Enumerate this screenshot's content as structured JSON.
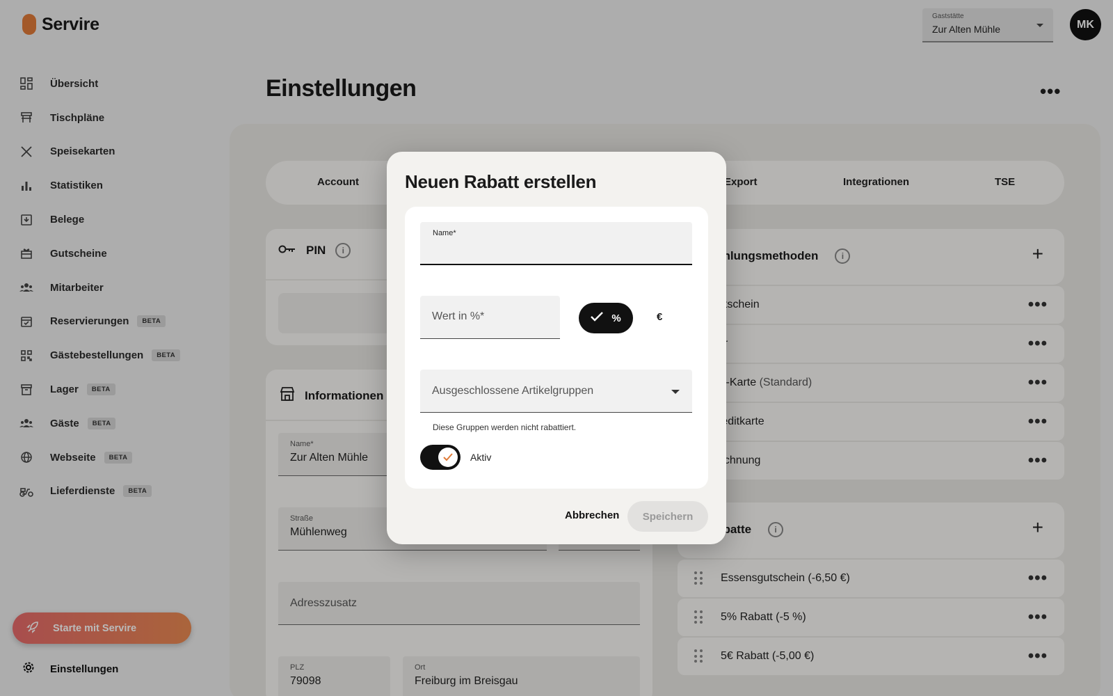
{
  "app": {
    "name": "Servire"
  },
  "sidebar": {
    "items": [
      {
        "label": "Übersicht",
        "icon": "dashboard-icon"
      },
      {
        "label": "Tischpläne",
        "icon": "table-icon"
      },
      {
        "label": "Speisekarten",
        "icon": "cutlery-icon"
      },
      {
        "label": "Statistiken",
        "icon": "bar-chart-icon"
      },
      {
        "label": "Belege",
        "icon": "receipt-icon"
      },
      {
        "label": "Gutscheine",
        "icon": "gift-icon"
      },
      {
        "label": "Mitarbeiter",
        "icon": "staff-icon"
      },
      {
        "label": "Reservierungen",
        "badge": "BETA",
        "icon": "calendar-icon"
      },
      {
        "label": "Gästebestellungen",
        "badge": "BETA",
        "icon": "qr-code-icon"
      },
      {
        "label": "Lager",
        "badge": "BETA",
        "icon": "archive-icon"
      },
      {
        "label": "Gäste",
        "badge": "BETA",
        "icon": "guests-icon"
      },
      {
        "label": "Webseite",
        "badge": "BETA",
        "icon": "globe-icon"
      },
      {
        "label": "Lieferdienste",
        "badge": "BETA",
        "icon": "scooter-icon"
      }
    ],
    "start_button": "Starte mit Servire",
    "settings_label": "Einstellungen"
  },
  "header": {
    "venue_caption": "Gaststätte",
    "venue_value": "Zur Alten Mühle",
    "avatar_initials": "MK"
  },
  "page": {
    "title": "Einstellungen",
    "more": "•••"
  },
  "tabs": [
    "Account",
    "Export",
    "Integrationen",
    "TSE"
  ],
  "pin_card": {
    "title": "PIN"
  },
  "info_card": {
    "title": "Informationen",
    "fields": {
      "name_caption": "Name*",
      "name_value": "Zur Alten Mühle",
      "street_caption": "Straße",
      "street_value": "Mühlenweg",
      "address_extra_placeholder": "Adresszusatz",
      "zip_caption": "PLZ",
      "zip_value": "79098",
      "city_caption": "Ort",
      "city_value": "Freiburg im Breisgau"
    }
  },
  "payment_card": {
    "title": "ahlungsmethoden",
    "rows": [
      "utschein",
      "ar",
      "C-Karte",
      "reditkarte",
      "echnung"
    ],
    "standard_suffix": "(Standard)"
  },
  "discount_card": {
    "title": "abatte",
    "rows": [
      "Essensgutschein (-6,50 €)",
      "5% Rabatt (-5 %)",
      "5€ Rabatt (-5,00 €)"
    ]
  },
  "dialog": {
    "title": "Neuen Rabatt erstellen",
    "name_caption": "Name*",
    "value_placeholder": "Wert in %*",
    "percent_label": "%",
    "euro_label": "€",
    "excluded_placeholder": "Ausgeschlossene Artikelgruppen",
    "excluded_hint": "Diese Gruppen werden nicht rabattiert.",
    "active_label": "Aktiv",
    "cancel": "Abbrechen",
    "save": "Speichern"
  },
  "colors": {
    "brand": "#e07b39",
    "start_gradient_from": "#e76b6b",
    "start_gradient_to": "#e98a52",
    "primary_dark": "#111111"
  }
}
